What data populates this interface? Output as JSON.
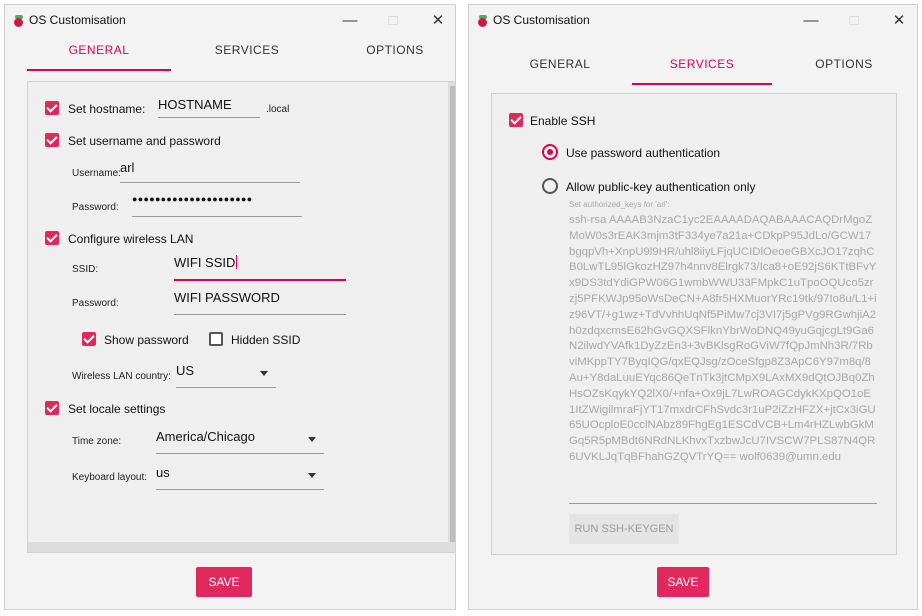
{
  "accent_color": "#e2004e",
  "left_window": {
    "title": "OS Customisation",
    "window_buttons": {
      "minimize": "—",
      "maximize": "□",
      "close": "✕"
    },
    "tabs": [
      "GENERAL",
      "SERVICES",
      "OPTIONS"
    ],
    "active_tab": "GENERAL",
    "general": {
      "hostname": {
        "label": "Set hostname:",
        "value": "HOSTNAME",
        "suffix": ".local",
        "checked": true
      },
      "user": {
        "label": "Set username and password",
        "checked": true,
        "username_label": "Username:",
        "username_value": "arl",
        "password_label": "Password:",
        "password_value": "●●●●●●●●●●●●●●●●●●●●●"
      },
      "wlan": {
        "label": "Configure wireless LAN",
        "checked": true,
        "ssid_label": "SSID:",
        "ssid_value": "WIFI SSID",
        "password_label": "Password:",
        "password_value": "WIFI PASSWORD",
        "show_password_label": "Show password",
        "show_password_checked": true,
        "hidden_ssid_label": "Hidden SSID",
        "hidden_ssid_checked": false,
        "country_label": "Wireless LAN country:",
        "country_value": "US"
      },
      "locale": {
        "label": "Set locale settings",
        "checked": true,
        "timezone_label": "Time zone:",
        "timezone_value": "America/Chicago",
        "keyboard_label": "Keyboard layout:",
        "keyboard_value": "us"
      }
    },
    "save_label": "SAVE"
  },
  "right_window": {
    "title": "OS Customisation",
    "window_buttons": {
      "minimize": "—",
      "maximize": "□",
      "close": "✕"
    },
    "tabs": [
      "GENERAL",
      "SERVICES",
      "OPTIONS"
    ],
    "active_tab": "SERVICES",
    "services": {
      "enable_ssh_label": "Enable SSH",
      "enable_ssh_checked": true,
      "password_auth_label": "Use password authentication",
      "password_auth_selected": true,
      "pubkey_auth_label": "Allow public-key authentication only",
      "pubkey_auth_selected": false,
      "authorized_keys_label": "Set authorized_keys for 'arl':",
      "authorized_keys_value": "ssh-rsa AAAAB3NzaC1yc2EAAAADAQABAAACAQDrMgoZMoW0s3rEAK3mjm3tF334ye7a21a+CDkpP95JdLo/GCW17bgqpVh+XnpU9l9HR/uhl8iiyLFjqUCIDlOeoeGBXcJO17zqhCB0LwTL95lGkozHZ97h4nnv8Elrgk73/Ica8+oE92jS6KTtBFvYx9DS3tdYdiGPW06G1wmbWWU33FMpkC1uTpoOQUco5zrzj5PFKWJp95oWsDeCN+A8fr5HXMuorYRc19tk/97Io8u/L1+iz96VT/+g1wz+TdVvhhUqNf5PiMw7cj3VI7j5gPVg9RGwhjiA2h0zdqxcmsE62hGvGQXSFlknYbrWoDNQ49yuGqjcgLt9Ga6N2ilwdYVAfk1DyZzEn3+3vBKlsgRoGViW7fQpJmNh3R/7RbviMKppTY7ByqIQG/qxEQJsg/zOceSfgp8Z3ApC6Y97m8q/8Au+Y8daLuuEYqc86QeTnTk3jtCMpX9LAxMX9dQtOJBq0ZhHsOZsKqykYQ2lX0/+nfa+Ox9jL7LwROAGCdykKXpQO1oE1ItZWigilmraFjYT17mxdrCFhSvdc3r1uP2iZzHFZX+jtCx3iGU65UOcploE0cclNAbz89FhgEg1ESCdVCB+Lm4rHZLwbGkMGq5R5pMBdt6NRdNLKhvxTxzbwJcU7IVSCW7PLS87N4QR6UVKLJqTqBFhahGZQVTrYQ== wolf0639@umn.edu",
      "keygen_label": "RUN SSH-KEYGEN"
    },
    "save_label": "SAVE"
  }
}
